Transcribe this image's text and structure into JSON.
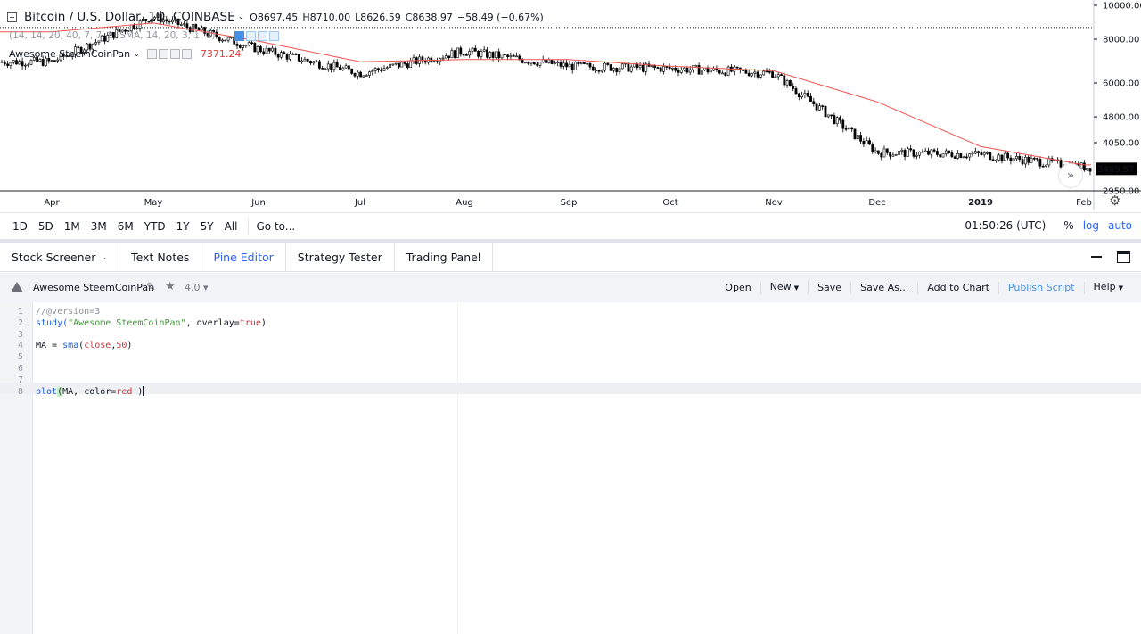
{
  "chart": {
    "symbol": "Bitcoin / U.S. Dollar, 1D, COINBASE",
    "ohlc": {
      "open": "O8697.45",
      "high": "H8710.00",
      "low": "L8626.59",
      "close": "C8638.97",
      "change": "−58.49 (−0.67%)"
    },
    "hidden_indicator_text": "(14, 14, 20, 40, 7, 7, 1, SMA, 14, 20, 3, 1, 1)",
    "indicator_name": "Awesome SteemCoinPan",
    "indicator_value": "7371.24",
    "current_price_label": "3409.57",
    "price_axis_labels": [
      "10000.00",
      "8000.00",
      "6000.00",
      "4800.00",
      "4050.00",
      "2950.00"
    ],
    "month_labels": [
      "Apr",
      "May",
      "Jun",
      "Jul",
      "Aug",
      "Sep",
      "Oct",
      "Nov",
      "Dec",
      "2019",
      "Feb"
    ],
    "colors": {
      "ma_line": "#ef5350",
      "candles": "#000000",
      "price_tag_bg": "#000000",
      "accent": "#2962ff"
    },
    "scroll_icon": "double-chevron-right-icon",
    "settings_icon": "gear-icon"
  },
  "chart_data": {
    "type": "line",
    "title": "Bitcoin / U.S. Dollar, 1D, COINBASE",
    "x": [
      "Apr",
      "May",
      "Jun",
      "Jul",
      "Aug",
      "Sep",
      "Oct",
      "Nov",
      "Dec",
      "2019",
      "Feb"
    ],
    "series": [
      {
        "name": "",
        "values": [
          6900,
          9300,
          7500,
          6400,
          7400,
          6700,
          6600,
          6400,
          3800,
          3750,
          3450
        ]
      },
      {
        "name": "Awesome SteemCoinPan",
        "values": [
          8400,
          8900,
          7900,
          6900,
          7000,
          7000,
          6700,
          6500,
          5300,
          3950,
          3500
        ]
      }
    ],
    "ylim": [
      2950,
      10000
    ],
    "log_scale": true,
    "xlabel": "",
    "ylabel": ""
  },
  "period_bar": {
    "ranges": [
      "1D",
      "5D",
      "1M",
      "3M",
      "6M",
      "YTD",
      "1Y",
      "5Y",
      "All"
    ],
    "goto": "Go to...",
    "clock": "01:50:26 (UTC)",
    "percent": "%",
    "log": "log",
    "auto": "auto"
  },
  "tabs": [
    {
      "label": "Stock Screener",
      "caret": "⌄",
      "active": false
    },
    {
      "label": "Text Notes",
      "active": false
    },
    {
      "label": "Pine Editor",
      "active": true
    },
    {
      "label": "Strategy Tester",
      "active": false
    },
    {
      "label": "Trading Panel",
      "active": false
    }
  ],
  "editor": {
    "script_name": "Awesome SteemCoinPan",
    "version": "4.0",
    "actions": [
      "Open",
      "New",
      "Save",
      "Save As...",
      "Add to Chart",
      "Publish Script",
      "Help"
    ],
    "lines": [
      {
        "n": "1",
        "tokens": [
          {
            "t": "//@version=3",
            "c": "comment"
          }
        ]
      },
      {
        "n": "2",
        "tokens": [
          {
            "t": "study(",
            "c": "func"
          },
          {
            "t": "\"Awesome SteemCoinPan\"",
            "c": "str"
          },
          {
            "t": ", overlay=",
            "c": "plain"
          },
          {
            "t": "true",
            "c": "kw"
          },
          {
            "t": ")",
            "c": "plain"
          }
        ]
      },
      {
        "n": "3",
        "tokens": []
      },
      {
        "n": "4",
        "tokens": [
          {
            "t": "MA = ",
            "c": "plain"
          },
          {
            "t": "sma",
            "c": "func"
          },
          {
            "t": "(",
            "c": "plain"
          },
          {
            "t": "close",
            "c": "kw"
          },
          {
            "t": ",",
            "c": "plain"
          },
          {
            "t": "50",
            "c": "num"
          },
          {
            "t": ")",
            "c": "plain"
          }
        ]
      },
      {
        "n": "5",
        "tokens": []
      },
      {
        "n": "6",
        "tokens": []
      },
      {
        "n": "7",
        "tokens": []
      },
      {
        "n": "8",
        "tokens": [
          {
            "t": "plot",
            "c": "func"
          },
          {
            "t": "(",
            "c": "paren"
          },
          {
            "t": "MA, color=",
            "c": "plain"
          },
          {
            "t": "red",
            "c": "kw"
          },
          {
            "t": " )",
            "c": "plain"
          }
        ]
      }
    ]
  }
}
